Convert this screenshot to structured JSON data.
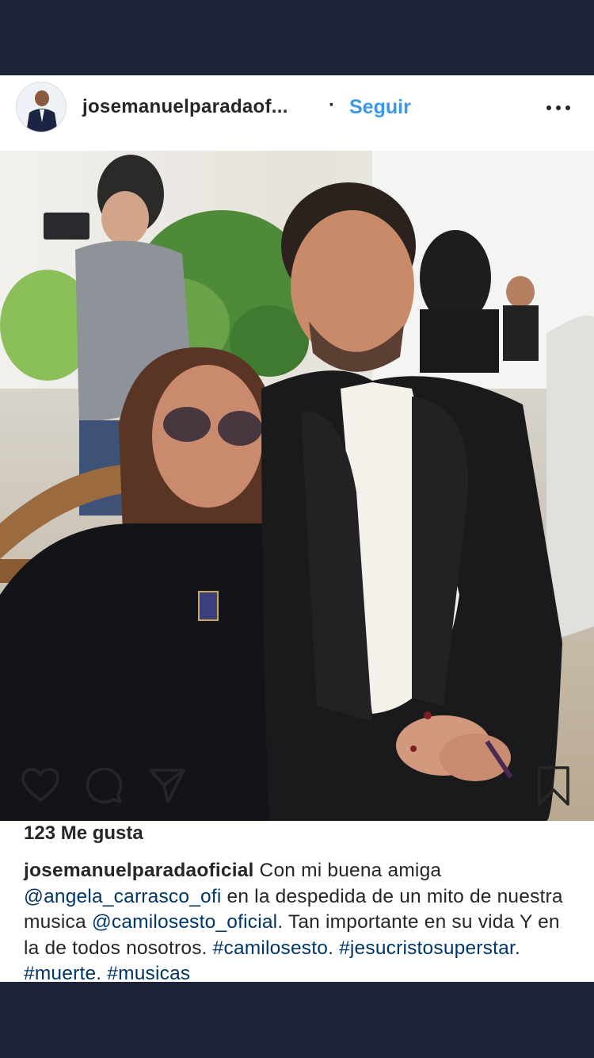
{
  "post": {
    "username": "josemanuelparadaof...",
    "separator": "·",
    "follow_label": "Seguir"
  },
  "icons": {
    "avatar": "profile-avatar",
    "more": "ellipsis-icon",
    "like": "heart-icon",
    "comment": "comment-bubble-icon",
    "share": "paper-plane-icon",
    "save": "bookmark-icon"
  },
  "likes": {
    "text": "123 Me gusta"
  },
  "caption": {
    "username": "josemanuelparadaoficial",
    "parts": [
      " Con mi buena amiga ",
      "@angela_carrasco_ofi",
      "  en la despedida de un mito de nuestra musica ",
      "@camilosesto_oficial",
      ". Tan importante en su vida  Y  en la de todos nosotros. ",
      "#camilosesto",
      ". ",
      "#jesucristosuperstar",
      ". ",
      "#muerte",
      ". ",
      "#musicas"
    ]
  },
  "colors": {
    "frame": "#1c2237",
    "link": "#003569",
    "follow": "#3897f0",
    "text": "#262626"
  }
}
